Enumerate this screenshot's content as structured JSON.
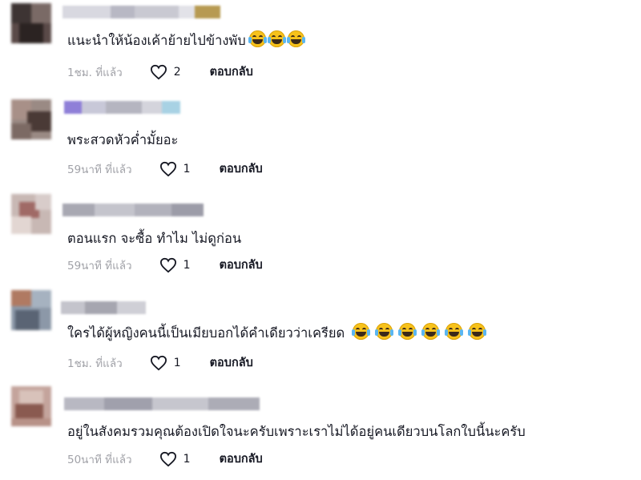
{
  "colors": {
    "time_gray": "#a1a2a8",
    "text": "#161823",
    "emoji_yellow": "#f7c21b"
  },
  "comments": [
    {
      "text": "แนะนำให้น้องเค้าย้ายไปข้างพับ",
      "emoji_count": 3,
      "time": "1ชม. ที่แล้ว",
      "likes": "2",
      "reply_label": "ตอบกลับ"
    },
    {
      "text": "พระสวดหัวค่ำมั้ยอะ",
      "emoji_count": 0,
      "time": "59นาที ที่แล้ว",
      "likes": "1",
      "reply_label": "ตอบกลับ"
    },
    {
      "text": "ตอนแรก จะซื้อ ทำไม ไม่ดูก่อน",
      "emoji_count": 0,
      "time": "59นาที ที่แล้ว",
      "likes": "1",
      "reply_label": "ตอบกลับ"
    },
    {
      "text": "ใครได้ผู้หญิงคนนี้เป็นเมียบอกได้คำเดียวว่าเครียด",
      "emoji_count": 6,
      "time": "1ชม. ที่แล้ว",
      "likes": "1",
      "reply_label": "ตอบกลับ"
    },
    {
      "text": "อยู่ในสังคมรวมคุณต้องเปิดใจนะครับเพราะเราไม่ได้อยู่คนเดียวบนโลกใบนี้นะครับ",
      "emoji_count": 0,
      "time": "50นาที ที่แล้ว",
      "likes": "1",
      "reply_label": "ตอบกลับ"
    }
  ],
  "icons": {
    "like": "heart-outline-icon",
    "emoji": "laughing-tears-emoji"
  }
}
